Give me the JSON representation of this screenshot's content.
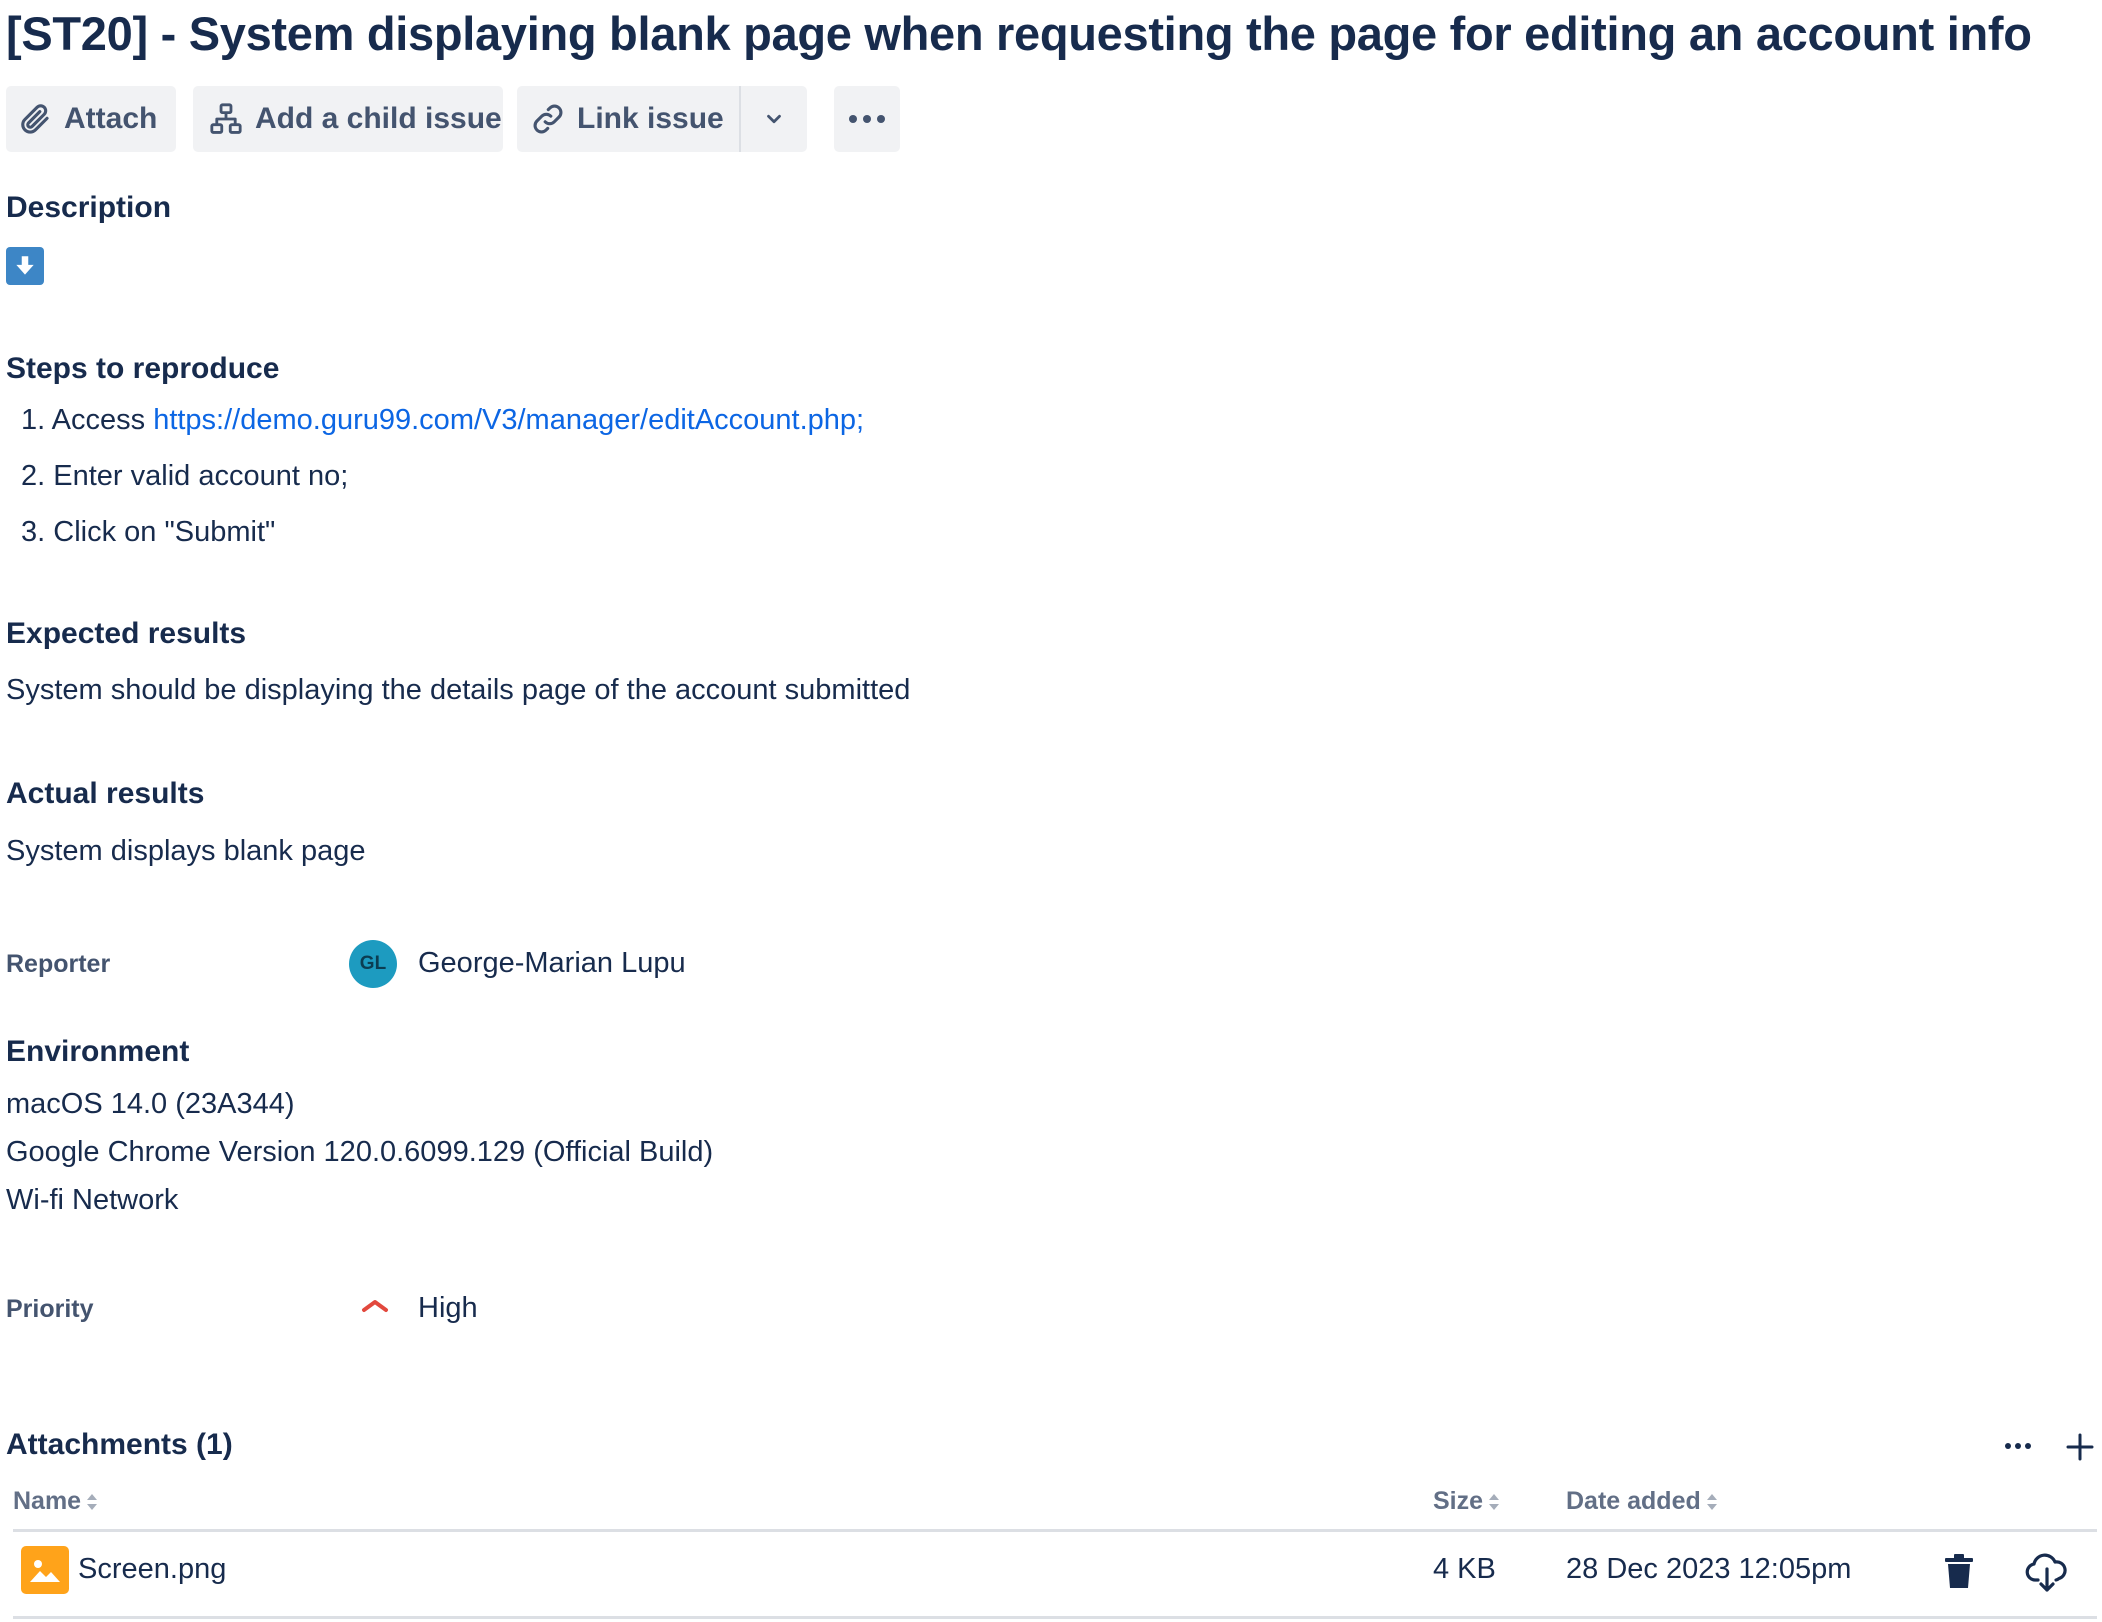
{
  "issue": {
    "title": "[ST20] - System displaying blank page when requesting the page for editing an account info"
  },
  "toolbar": {
    "attach_label": "Attach",
    "add_child_label": "Add a child issue",
    "link_issue_label": "Link issue"
  },
  "description": {
    "heading": "Description",
    "steps_heading": "Steps to reproduce",
    "steps": [
      {
        "number": "1.",
        "prefix": "Access ",
        "link": "https://demo.guru99.com/V3/manager/editAccount.php;"
      },
      {
        "number": "2.",
        "text": "Enter valid account no;"
      },
      {
        "number": "3.",
        "text": "Click on \"Submit\""
      }
    ],
    "expected_heading": "Expected results",
    "expected_text": "System should be displaying the details page of the account submitted",
    "actual_heading": "Actual results",
    "actual_text": "System displays blank page"
  },
  "reporter": {
    "label": "Reporter",
    "initials": "GL",
    "name": "George-Marian Lupu",
    "avatar_color": "#1d9bc0"
  },
  "environment": {
    "heading": "Environment",
    "lines": [
      "macOS 14.0 (23A344)",
      "Google Chrome Version 120.0.6099.129 (Official Build)",
      "Wi-fi Network"
    ]
  },
  "priority": {
    "label": "Priority",
    "value": "High",
    "icon": "chevron-up-icon",
    "color": "#e2483d"
  },
  "attachments": {
    "heading": "Attachments (1)",
    "columns": {
      "name": "Name",
      "size": "Size",
      "date": "Date added"
    },
    "files": [
      {
        "name": "Screen.png",
        "size": "4 KB",
        "date": "28 Dec 2023 12:05pm",
        "icon": "image-file-icon"
      }
    ]
  },
  "colors": {
    "text": "#172b4d",
    "link": "#0c66e4",
    "button_bg": "#f1f2f4",
    "subtle_text": "#44546f",
    "file_icon": "#ffa31a"
  }
}
